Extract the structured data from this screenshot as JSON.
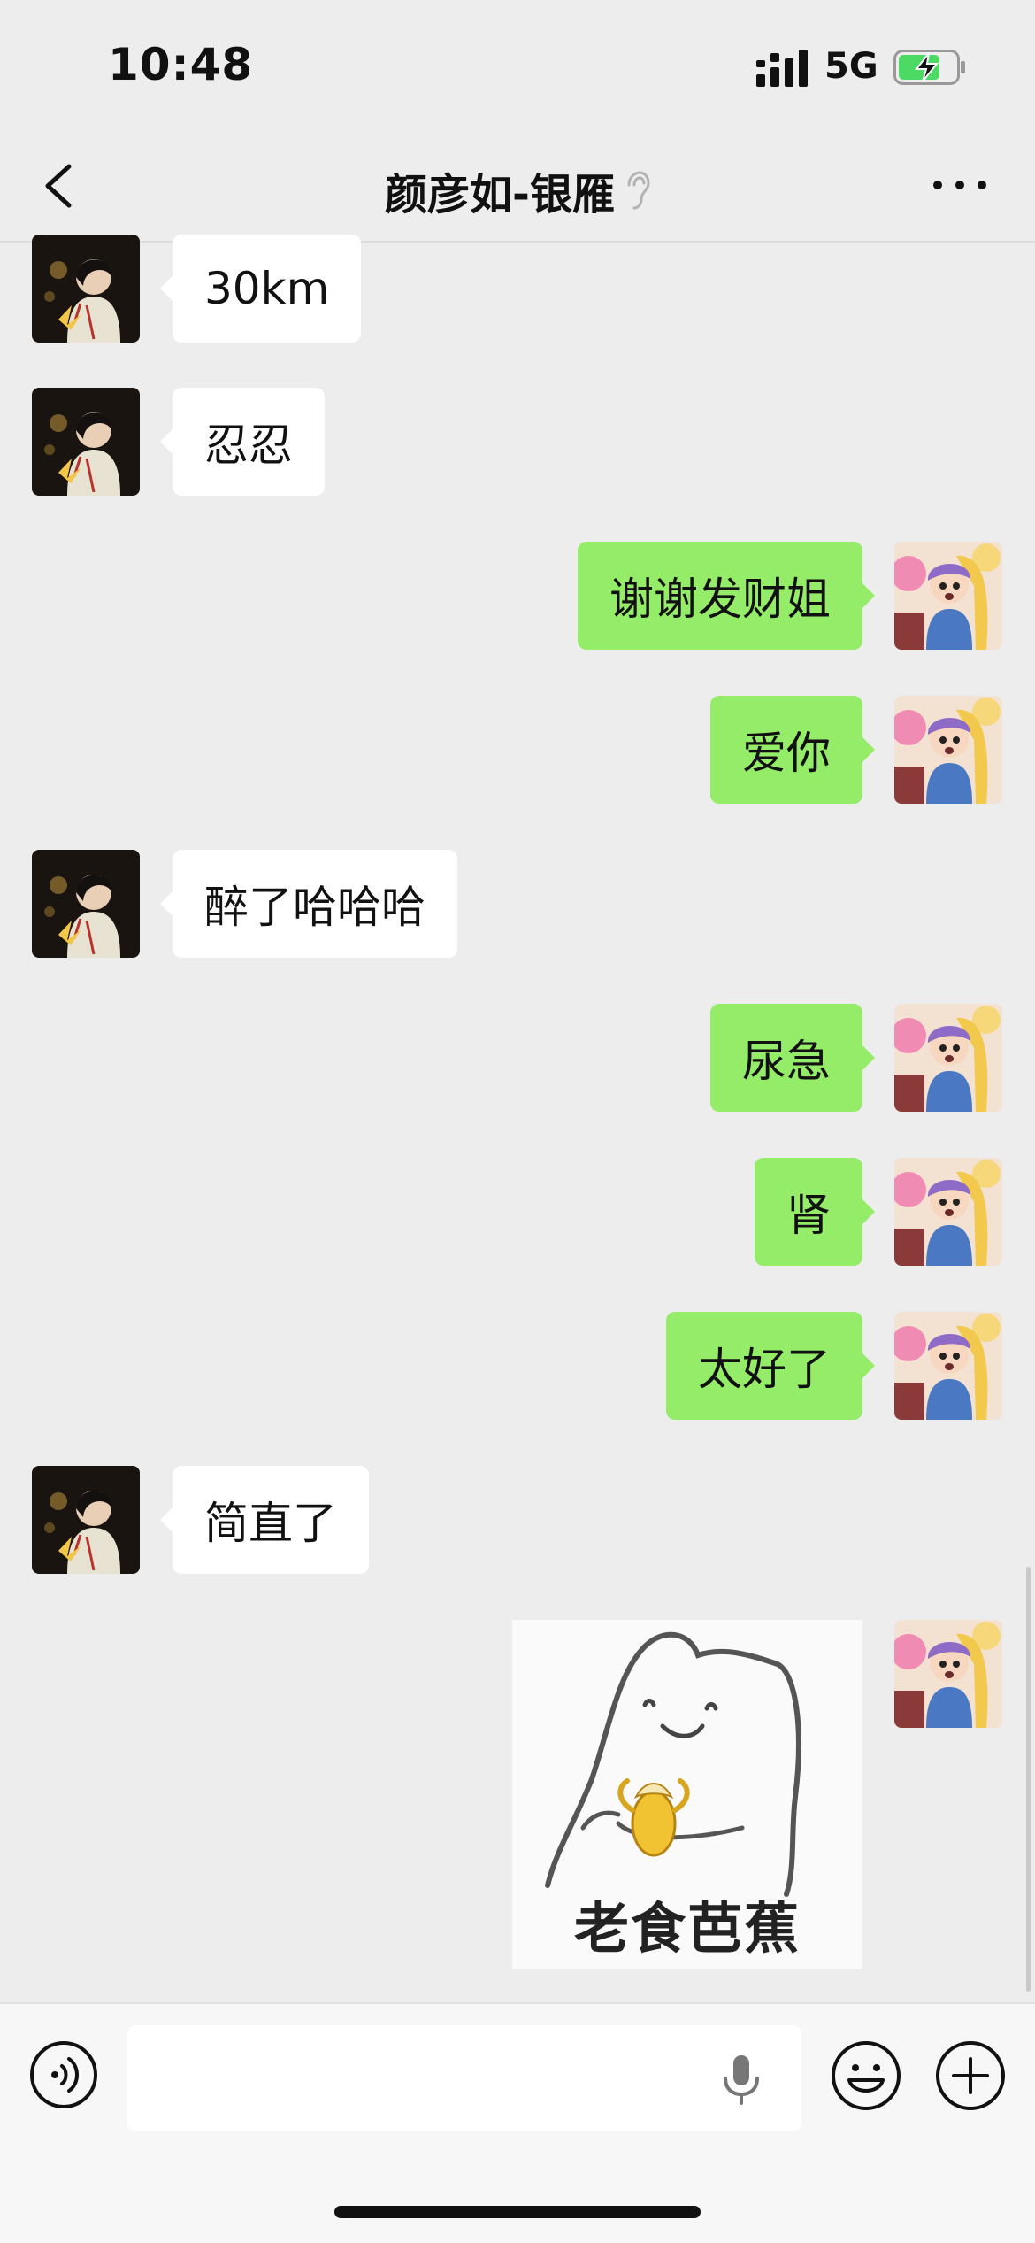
{
  "status_bar": {
    "time": "10:48",
    "network": "5G"
  },
  "nav": {
    "title": "颜彦如-银雁"
  },
  "messages": [
    {
      "side": "in",
      "text": "30km"
    },
    {
      "side": "in",
      "text": "忍忍"
    },
    {
      "side": "out",
      "text": "谢谢发财姐"
    },
    {
      "side": "out",
      "text": "爱你"
    },
    {
      "side": "in",
      "text": "醉了哈哈哈"
    },
    {
      "side": "out",
      "text": "尿急"
    },
    {
      "side": "out",
      "text": "肾"
    },
    {
      "side": "out",
      "text": "太好了"
    },
    {
      "side": "in",
      "text": "简直了"
    }
  ],
  "sticker": {
    "caption": "老食芭蕉"
  },
  "input": {
    "placeholder": ""
  },
  "colors": {
    "outgoing_bubble": "#95ec69",
    "incoming_bubble": "#ffffff",
    "background": "#ededed"
  }
}
